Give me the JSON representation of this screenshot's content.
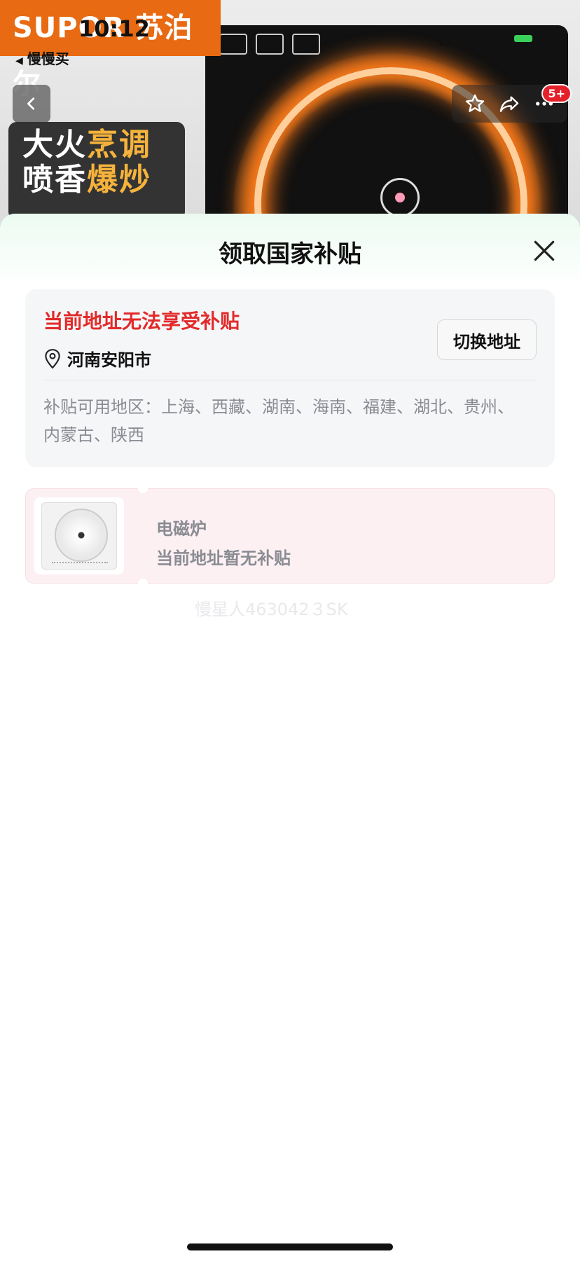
{
  "status_bar": {
    "time": "10:12",
    "back_app_label": "慢慢买"
  },
  "hero": {
    "brand": "SUPOR 苏泊尔",
    "promo_line1_a": "大火",
    "promo_line1_b": "烹调",
    "promo_line2_a": "喷香",
    "promo_line2_b": "爆炒",
    "badge": "5+"
  },
  "sheet": {
    "title": "领取国家补贴",
    "address_card": {
      "warning": "当前地址无法享受补贴",
      "location": "河南安阳市",
      "switch_button": "切换地址",
      "regions": "补贴可用地区：上海、西藏、湖南、海南、福建、湖北、贵州、内蒙古、陕西"
    },
    "product": {
      "name": "电磁炉",
      "status": "当前地址暂无补贴"
    },
    "watermark": "慢星人463042３SK"
  },
  "colors": {
    "warning_red": "#e22a2a",
    "brand_orange": "#e86a12",
    "muted_gray": "#8a8c93",
    "product_card_bg": "#fdf0f2"
  },
  "icons": [
    "back-chevron-icon",
    "star-icon",
    "share-icon",
    "more-icon",
    "close-icon",
    "location-pin-icon",
    "signal-icon",
    "wifi-icon",
    "battery-icon"
  ]
}
